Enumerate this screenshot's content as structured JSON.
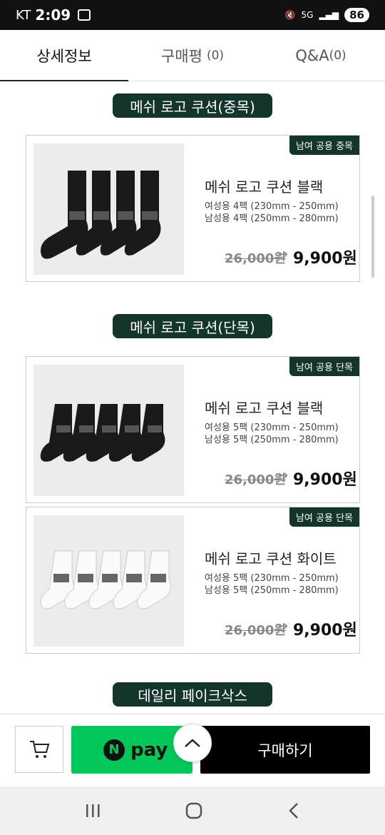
{
  "status": {
    "carrier": "KT",
    "time": "2:09",
    "net": "5G",
    "battery": "86"
  },
  "tabs": [
    {
      "label": "상세정보",
      "count": ""
    },
    {
      "label": "구매평",
      "count": "(0)"
    },
    {
      "label": "Q&A",
      "count": "(0)"
    }
  ],
  "sections": [
    {
      "title": "메쉬 로고 쿠션(중목)"
    },
    {
      "title": "메쉬 로고 쿠션(단목)"
    },
    {
      "title": "데일리 페이크삭스"
    }
  ],
  "products": [
    {
      "badge": "남여 공용 중목",
      "name": "메쉬 로고 쿠션 블랙",
      "info1": "여성용 4팩 (230mm - 250mm)",
      "info2": "남성용 4팩 (250mm - 280mm)",
      "old_price": "26,000원",
      "new_price": "9,900원"
    },
    {
      "badge": "남여 공용 단목",
      "name": "메쉬 로고 쿠션 블랙",
      "info1": "여성용 5팩 (230mm - 250mm)",
      "info2": "남성용 5팩 (250mm - 280mm)",
      "old_price": "26,000원",
      "new_price": "9,900원"
    },
    {
      "badge": "남여 공용 단목",
      "name": "메쉬 로고 쿠션 화이트",
      "info1": "여성용 5팩 (230mm - 250mm)",
      "info2": "남성용 5팩 (250mm - 280mm)",
      "old_price": "26,000원",
      "new_price": "9,900원"
    }
  ],
  "bottom": {
    "npay_n": "N",
    "npay_label": "pay",
    "buy_label": "구매하기"
  },
  "icons": [
    "cart-icon",
    "chevron-up-icon",
    "recent-apps-icon",
    "home-icon",
    "back-icon"
  ]
}
